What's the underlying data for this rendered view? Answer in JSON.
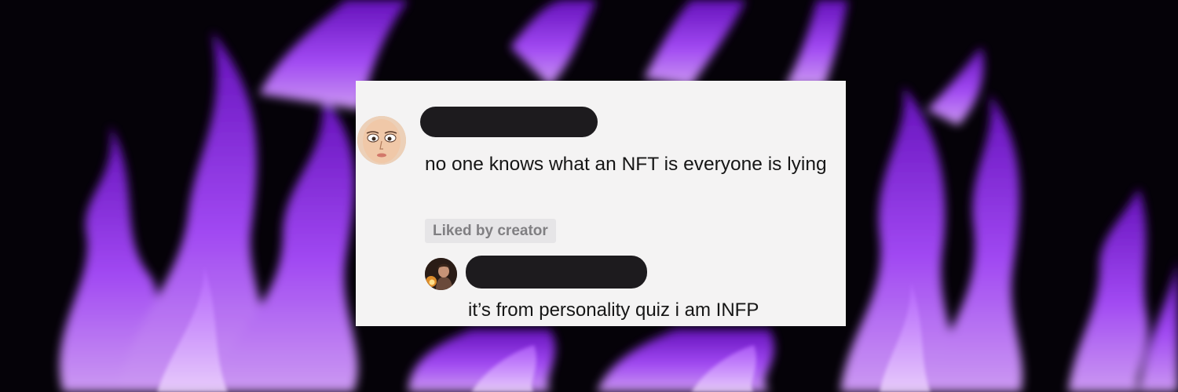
{
  "background": {
    "description_icon": "purple-flames",
    "colors": {
      "flame": "#a648ff",
      "flame_light": "#e6c2ff",
      "dark": "#050208"
    }
  },
  "card": {
    "background_color": "#f4f3f3",
    "comment": {
      "avatar_icon": "cartoon-face-avatar",
      "username_redacted": true,
      "text": "no one knows what an NFT is everyone is lying",
      "badge": "Liked by creator"
    },
    "reply": {
      "avatar_icon": "person-avatar",
      "username_redacted": true,
      "text": "it’s from personality quiz i am INFP"
    }
  }
}
